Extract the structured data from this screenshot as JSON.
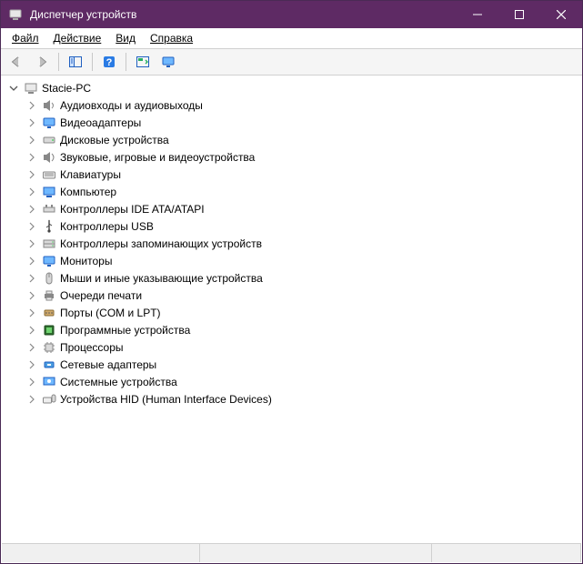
{
  "titlebar": {
    "title": "Диспетчер устройств"
  },
  "menu": {
    "file": "Файл",
    "action": "Действие",
    "view": "Вид",
    "help": "Справка"
  },
  "tree": {
    "root": "Stacie-PC",
    "items": [
      {
        "label": "Аудиовходы и аудиовыходы",
        "icon": "audio"
      },
      {
        "label": "Видеоадаптеры",
        "icon": "display"
      },
      {
        "label": "Дисковые устройства",
        "icon": "disk"
      },
      {
        "label": "Звуковые, игровые и видеоустройства",
        "icon": "sound"
      },
      {
        "label": "Клавиатуры",
        "icon": "keyboard"
      },
      {
        "label": "Компьютер",
        "icon": "computer"
      },
      {
        "label": "Контроллеры IDE ATA/ATAPI",
        "icon": "ide"
      },
      {
        "label": "Контроллеры USB",
        "icon": "usb"
      },
      {
        "label": "Контроллеры запоминающих устройств",
        "icon": "storage"
      },
      {
        "label": "Мониторы",
        "icon": "monitor"
      },
      {
        "label": "Мыши и иные указывающие устройства",
        "icon": "mouse"
      },
      {
        "label": "Очереди печати",
        "icon": "printer"
      },
      {
        "label": "Порты (COM и LPT)",
        "icon": "ports"
      },
      {
        "label": "Программные устройства",
        "icon": "software"
      },
      {
        "label": "Процессоры",
        "icon": "cpu"
      },
      {
        "label": "Сетевые адаптеры",
        "icon": "network"
      },
      {
        "label": "Системные устройства",
        "icon": "system"
      },
      {
        "label": "Устройства HID (Human Interface Devices)",
        "icon": "hid"
      }
    ]
  }
}
